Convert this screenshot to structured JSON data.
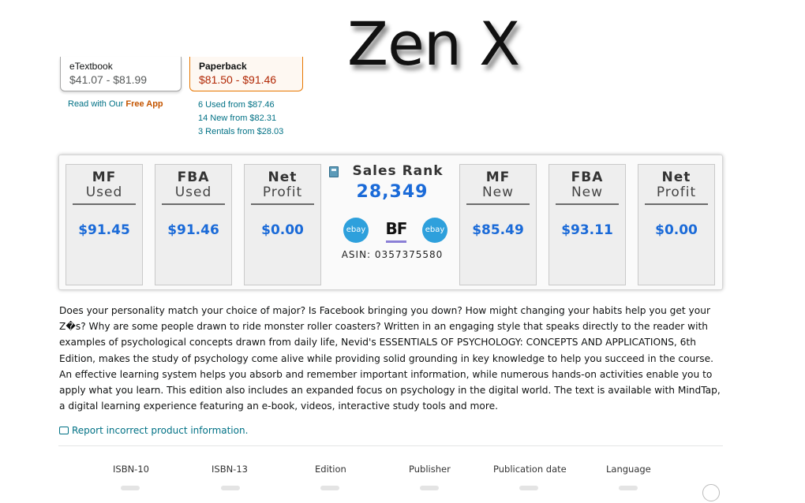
{
  "overlay_title": "Zen X",
  "formats": {
    "etextbook": {
      "name": "eTextbook",
      "price": "$41.07 - $81.99"
    },
    "paperback": {
      "name": "Paperback",
      "price": "$81.50 - $91.46"
    }
  },
  "free_app": {
    "prefix": "Read with Our ",
    "link": "Free App"
  },
  "offers": [
    {
      "label": "6 Used from ",
      "price": "$87.46"
    },
    {
      "label": "14 New from ",
      "price": "$82.31"
    },
    {
      "label": "3 Rentals from ",
      "price": "$28.03"
    }
  ],
  "cards": [
    {
      "top": "MF",
      "bottom": "Used",
      "value": "$91.45"
    },
    {
      "top": "FBA",
      "bottom": "Used",
      "value": "$91.46"
    },
    {
      "top": "Net",
      "bottom": "Profit",
      "value": "$0.00"
    },
    {
      "top": "MF",
      "bottom": "New",
      "value": "$85.49"
    },
    {
      "top": "FBA",
      "bottom": "New",
      "value": "$93.11"
    },
    {
      "top": "Net",
      "bottom": "Profit",
      "value": "$0.00"
    }
  ],
  "sales_rank": {
    "label": "Sales Rank",
    "value": "28,349",
    "ebay_left": "ebay",
    "bf": "BF",
    "ebay_right": "ebay",
    "asin": "ASIN: 0357375580"
  },
  "description": "Does your personality match your choice of major? Is Facebook bringing you down? How might changing your habits help you get your Z�s? Why are some people drawn to ride monster roller coasters? Written in an engaging style that speaks directly to the reader with examples of psychological concepts drawn from daily life, Nevid's ESSENTIALS OF PSYCHOLOGY: CONCEPTS AND APPLICATIONS, 6th Edition, makes the study of psychology come alive while providing solid grounding in key knowledge to help you succeed in the course. An effective learning system helps you absorb and remember important information, while numerous hands-on activities enable you to apply what you learn. This edition also includes an expanded focus on psychology in the digital world. The text is available with MindTap, a digital learning experience featuring an e-book, videos, interactive study tools and more.",
  "report_link": "Report incorrect product information.",
  "details": [
    "ISBN-10",
    "ISBN-13",
    "Edition",
    "Publisher",
    "Publication date",
    "Language"
  ],
  "colors": {
    "link": "#007185",
    "price_red": "#b12704",
    "value_blue": "#1a6ad8",
    "accent_orange": "#e77600",
    "ebay_blue": "#2ea0dc"
  }
}
